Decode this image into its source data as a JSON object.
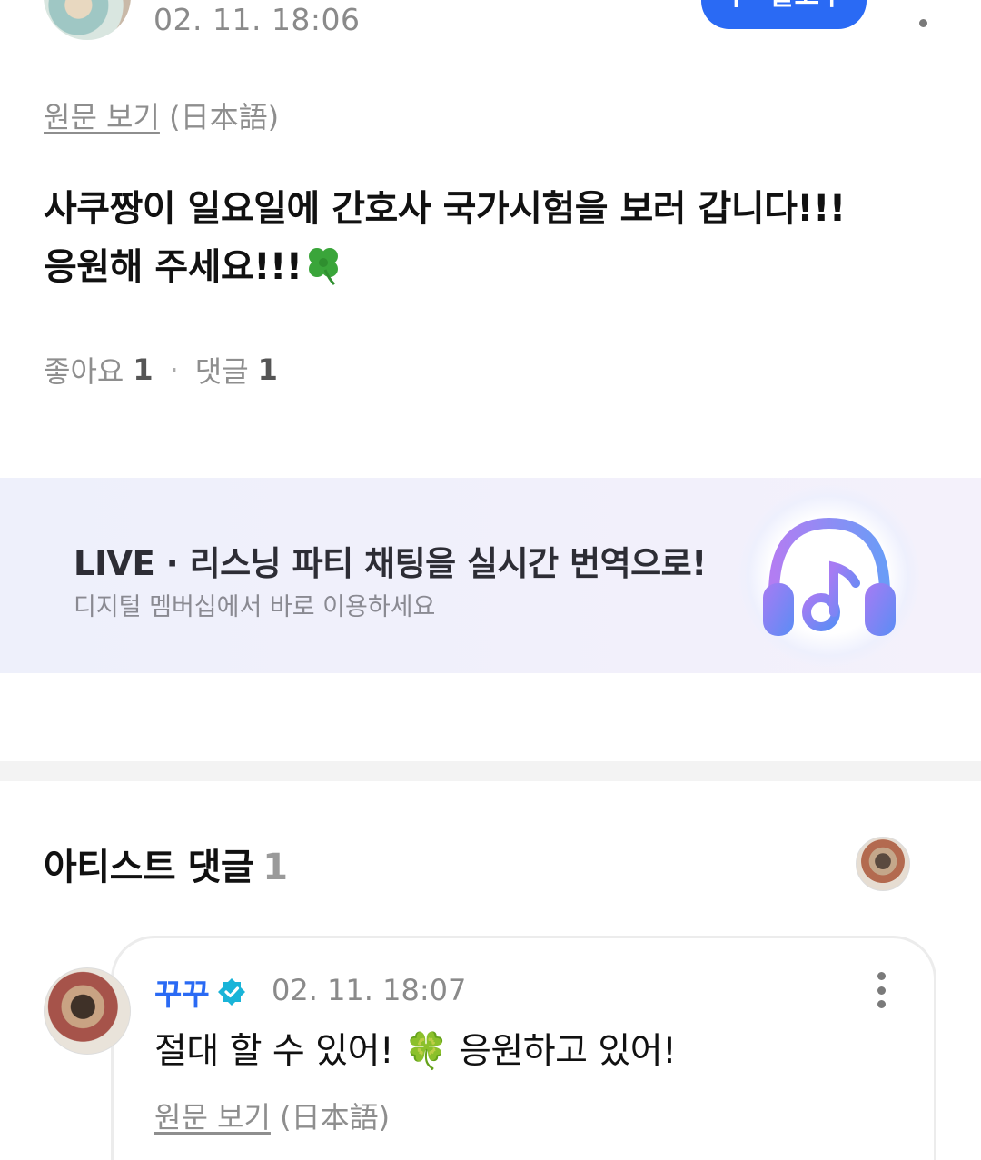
{
  "post": {
    "date": "02. 11. 18:06",
    "follow_label": "알고주",
    "follow_plus": "+",
    "original_link": "원문 보기",
    "original_lang": "(日本語)",
    "body_line1": "사쿠짱이 일요일에 간호사 국가시험을 보러 갑니다!!!",
    "body_line2": "응원해 주세요!!!",
    "likes_label": "좋아요",
    "likes_count": "1",
    "comments_label": "댓글",
    "comments_count": "1",
    "separator": "·"
  },
  "banner": {
    "title": "LIVE · 리스닝 파티 채팅을 실시간 번역으로!",
    "subtitle": "디지털 멤버십에서 바로 이용하세요",
    "icon": "headphones-music-icon"
  },
  "artist_comments": {
    "title": "아티스트 댓글",
    "count": "1",
    "comment": {
      "author": "꾸꾸",
      "date": "02. 11. 18:07",
      "text": "절대 할 수 있어! 🍀 응원하고 있어!",
      "original_link": "원문 보기",
      "original_lang": "(日本語)"
    }
  },
  "colors": {
    "accent": "#2a6af4",
    "verified": "#19b4d8",
    "muted_text": "#8a8a8a"
  }
}
